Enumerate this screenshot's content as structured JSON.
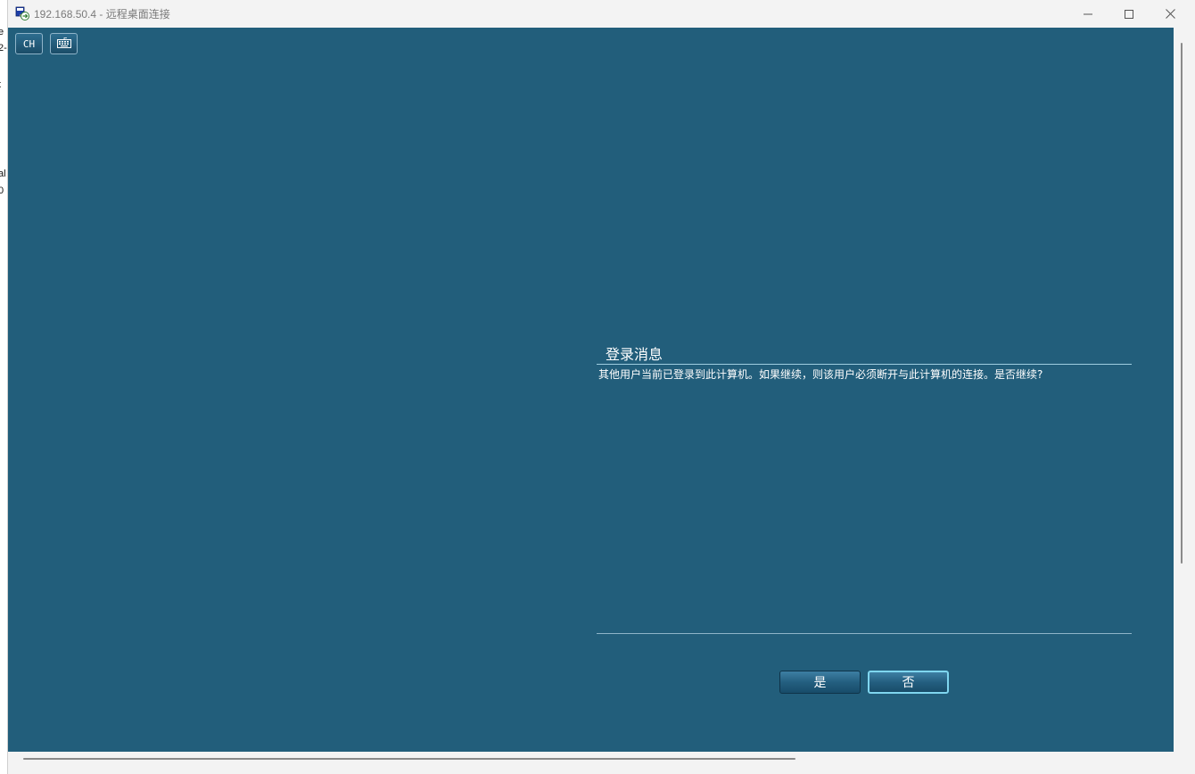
{
  "background_fragments": [
    "e",
    "2-",
    "t",
    "al",
    "0"
  ],
  "window": {
    "title": "192.168.50.4 - 远程桌面连接",
    "app_icon": "remote-desktop-icon",
    "controls": {
      "minimize": "minimize-icon",
      "maximize": "maximize-icon",
      "close": "close-icon"
    }
  },
  "toolbar": {
    "language_label": "CH",
    "keyboard_icon": "keyboard-icon"
  },
  "dialog": {
    "title": "登录消息",
    "message": "其他用户当前已登录到此计算机。如果继续，则该用户必须断开与此计算机的连接。是否继续?",
    "yes_label": "是",
    "no_label": "否"
  },
  "colors": {
    "rdp_background": "#225e7b",
    "button_gradient_top": "#3d7fa3",
    "focus_border": "#7fd6ef",
    "titlebar": "#f3f3f3"
  }
}
